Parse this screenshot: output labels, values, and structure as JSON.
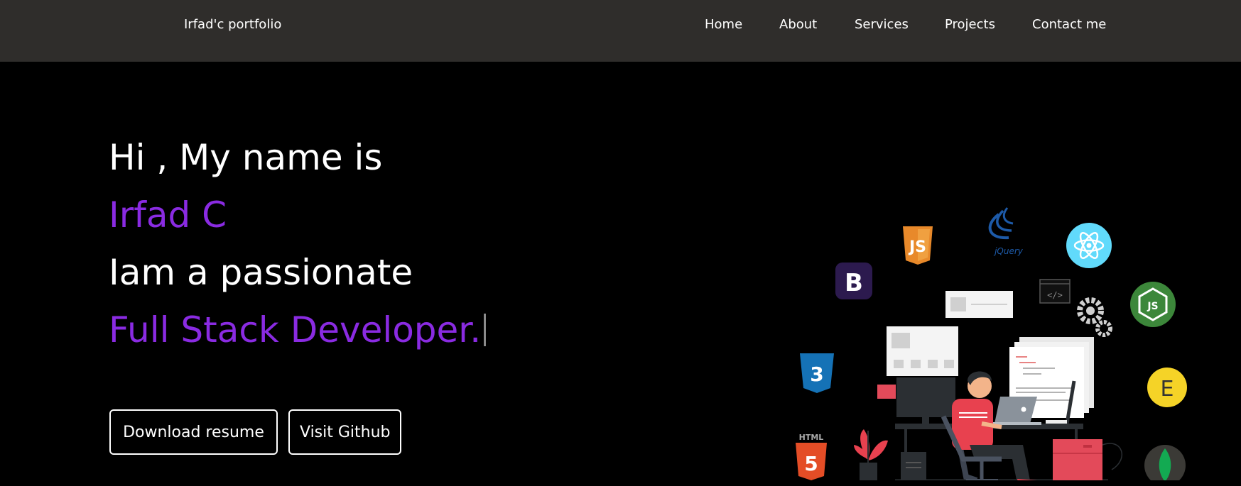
{
  "navbar": {
    "brand": "Irfad'c portfolio",
    "links": [
      "Home",
      "About",
      "Services",
      "Projects",
      "Contact me"
    ]
  },
  "hero": {
    "line1": "Hi , My name is",
    "line2": "Irfad C",
    "line3": "Iam a passionate",
    "line4": "Full Stack Developer.",
    "buttons": {
      "resume": "Download resume",
      "github": "Visit Github"
    }
  },
  "illustration": {
    "icons": [
      "javascript-icon",
      "jquery-icon",
      "react-icon",
      "bootstrap-icon",
      "nodejs-icon",
      "css3-icon",
      "express-icon",
      "html5-icon",
      "mongodb-icon"
    ],
    "badges": {
      "js": "JS",
      "jquery": "jQuery",
      "bootstrap": "B",
      "css": "3",
      "express": "E",
      "html_label": "HTML",
      "html": "5",
      "node": "JS"
    }
  },
  "colors": {
    "navbar_bg": "#2f2d2b",
    "background": "#000000",
    "accent_purple": "#8a2be2",
    "text": "#ffffff"
  }
}
